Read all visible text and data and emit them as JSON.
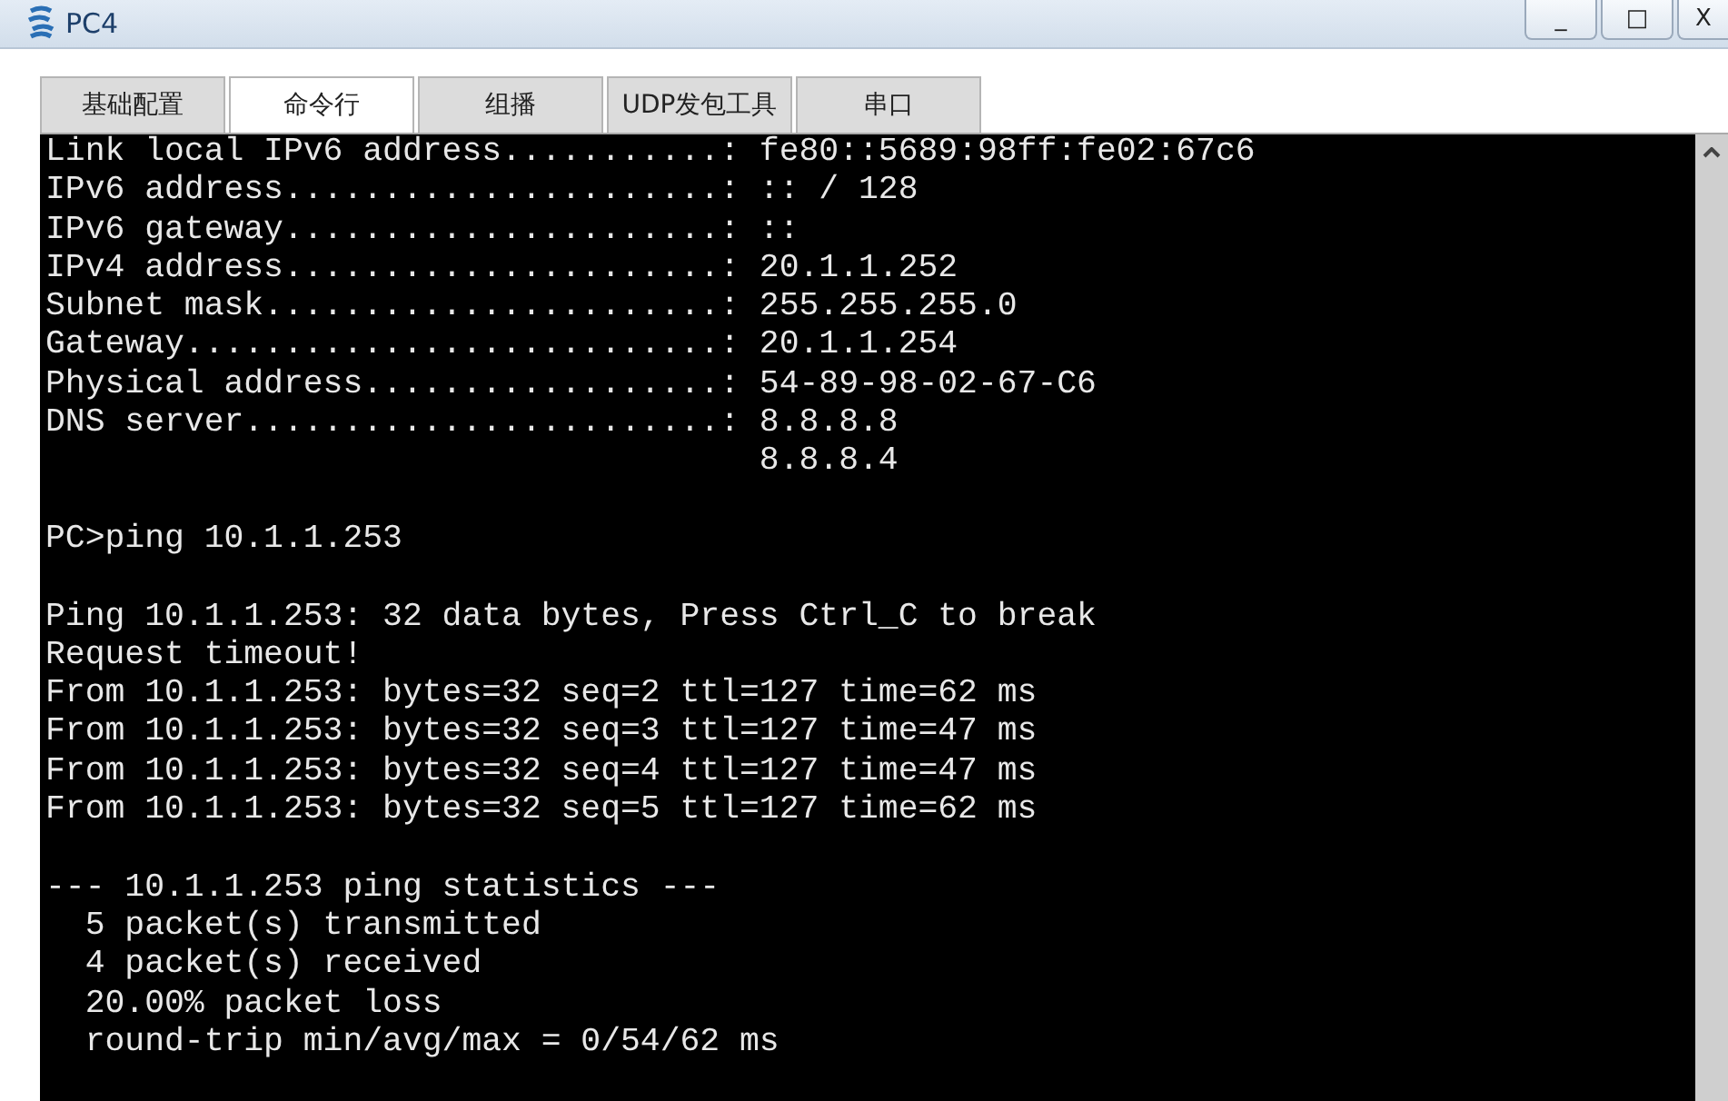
{
  "window": {
    "title": "PC4",
    "controls": [
      "_",
      "□",
      "X"
    ]
  },
  "tabs": [
    {
      "label": "基础配置",
      "selected": false
    },
    {
      "label": "命令行",
      "selected": true
    },
    {
      "label": "组播",
      "selected": false
    },
    {
      "label": "UDP发包工具",
      "selected": false
    },
    {
      "label": "串口",
      "selected": false
    }
  ],
  "terminal": {
    "blocks": [
      [
        "Link local IPv6 address...........: fe80::5689:98ff:fe02:67c6",
        "IPv6 address......................: :: / 128",
        "IPv6 gateway......................: ::",
        "IPv4 address......................: 20.1.1.252",
        "Subnet mask.......................: 255.255.255.0",
        "Gateway...........................: 20.1.1.254",
        "Physical address..................: 54-89-98-02-67-C6",
        "DNS server........................: 8.8.8.8",
        "                                    8.8.8.4"
      ],
      [
        "PC>ping 10.1.1.253"
      ],
      [
        "Ping 10.1.1.253: 32 data bytes, Press Ctrl_C to break",
        "Request timeout!",
        "From 10.1.1.253: bytes=32 seq=2 ttl=127 time=62 ms",
        "From 10.1.1.253: bytes=32 seq=3 ttl=127 time=47 ms",
        "From 10.1.1.253: bytes=32 seq=4 ttl=127 time=47 ms",
        "From 10.1.1.253: bytes=32 seq=5 ttl=127 time=62 ms"
      ],
      [
        "--- 10.1.1.253 ping statistics ---",
        "  5 packet(s) transmitted",
        "  4 packet(s) received",
        "  20.00% packet loss",
        "  round-trip min/avg/max = 0/54/62 ms"
      ]
    ]
  }
}
